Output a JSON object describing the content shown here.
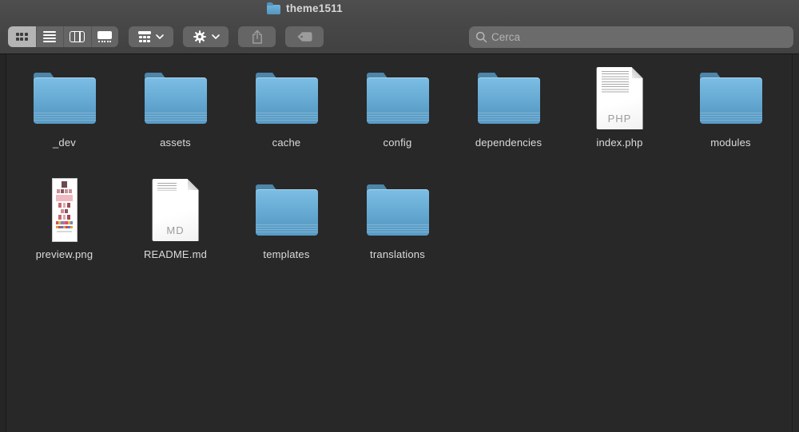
{
  "titlebar": {
    "title": "theme1511"
  },
  "toolbar": {
    "search_placeholder": "Cerca",
    "icons": {
      "view_icons": "grid-of-squares",
      "view_list": "horizontal-lines",
      "view_columns": "three-columns",
      "view_gallery": "rect-with-dots",
      "group": "group-grid-with-chevron",
      "action": "gear-with-chevron",
      "share": "box-with-up-arrow",
      "tags": "tag-shape",
      "search": "magnifier"
    }
  },
  "grid": {
    "rows": [
      [
        {
          "label": "_dev",
          "type": "folder"
        },
        {
          "label": "assets",
          "type": "folder"
        },
        {
          "label": "cache",
          "type": "folder"
        },
        {
          "label": "config",
          "type": "folder"
        },
        {
          "label": "dependencies",
          "type": "folder"
        },
        {
          "label": "index.php",
          "type": "file",
          "badge": "PHP"
        },
        {
          "label": "modules",
          "type": "folder"
        }
      ],
      [
        {
          "label": "preview.png",
          "type": "image"
        },
        {
          "label": "README.md",
          "type": "file",
          "badge": "MD"
        },
        {
          "label": "templates",
          "type": "folder"
        },
        {
          "label": "translations",
          "type": "folder"
        }
      ]
    ]
  },
  "colors": {
    "folder_blue": "#68abd4",
    "folder_tab": "#4d86a9",
    "titlebar_bg": "#4a4a4a",
    "toolbar_bg": "#444444",
    "content_bg": "#282828",
    "button_bg": "#656565",
    "selected_segment": "#b4b4b4",
    "search_bg": "#6b6b6b",
    "label_text": "#dcdcdc"
  }
}
